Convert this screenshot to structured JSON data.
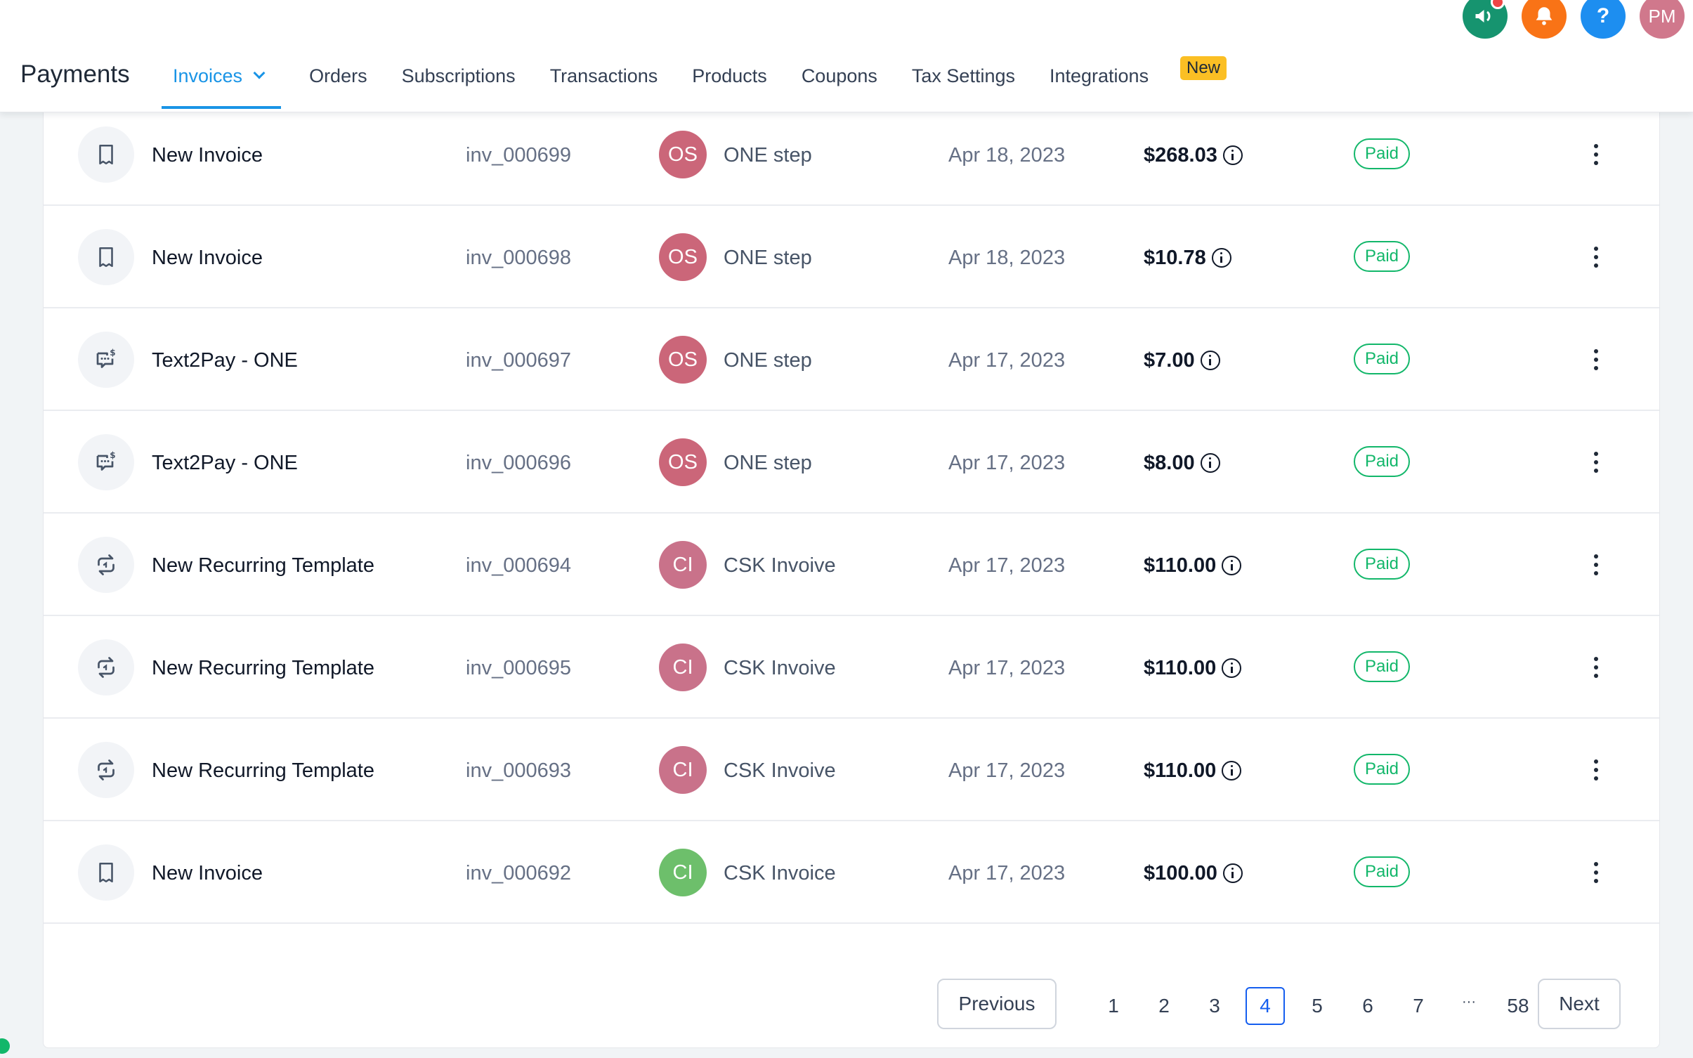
{
  "header": {
    "title": "Payments",
    "tabs": [
      {
        "label": "Invoices",
        "active": true
      },
      {
        "label": "Orders"
      },
      {
        "label": "Subscriptions"
      },
      {
        "label": "Transactions"
      },
      {
        "label": "Products"
      },
      {
        "label": "Coupons"
      },
      {
        "label": "Tax Settings"
      },
      {
        "label": "Integrations"
      }
    ],
    "new_badge": "New",
    "user_initials": "PM",
    "icons": [
      "megaphone-icon",
      "bell-icon",
      "help-icon",
      "avatar"
    ],
    "colors": {
      "megaphone": "#16946f",
      "bell": "#f97316",
      "help": "#1d8ef0",
      "avatar": "#d0788c",
      "accent": "#1994e6"
    }
  },
  "rows": [
    {
      "type_icon": "receipt-icon",
      "name": "New Invoice",
      "number": "inv_000699",
      "customer_initials": "OS",
      "customer": "ONE step",
      "customer_color": "#cb6679",
      "date": "Apr 18, 2023",
      "amount": "$268.03",
      "status": "Paid"
    },
    {
      "type_icon": "receipt-icon",
      "name": "New Invoice",
      "number": "inv_000698",
      "customer_initials": "OS",
      "customer": "ONE step",
      "customer_color": "#cb6679",
      "date": "Apr 18, 2023",
      "amount": "$10.78",
      "status": "Paid"
    },
    {
      "type_icon": "text2pay-icon",
      "name": "Text2Pay - ONE",
      "number": "inv_000697",
      "customer_initials": "OS",
      "customer": "ONE step",
      "customer_color": "#cb6679",
      "date": "Apr 17, 2023",
      "amount": "$7.00",
      "status": "Paid"
    },
    {
      "type_icon": "text2pay-icon",
      "name": "Text2Pay - ONE",
      "number": "inv_000696",
      "customer_initials": "OS",
      "customer": "ONE step",
      "customer_color": "#cb6679",
      "date": "Apr 17, 2023",
      "amount": "$8.00",
      "status": "Paid"
    },
    {
      "type_icon": "recurring-icon",
      "name": "New Recurring Template",
      "number": "inv_000694",
      "customer_initials": "CI",
      "customer": "CSK Invoive",
      "customer_color": "#c9728a",
      "date": "Apr 17, 2023",
      "amount": "$110.00",
      "status": "Paid"
    },
    {
      "type_icon": "recurring-icon",
      "name": "New Recurring Template",
      "number": "inv_000695",
      "customer_initials": "CI",
      "customer": "CSK Invoive",
      "customer_color": "#c9728a",
      "date": "Apr 17, 2023",
      "amount": "$110.00",
      "status": "Paid"
    },
    {
      "type_icon": "recurring-icon",
      "name": "New Recurring Template",
      "number": "inv_000693",
      "customer_initials": "CI",
      "customer": "CSK Invoive",
      "customer_color": "#c9728a",
      "date": "Apr 17, 2023",
      "amount": "$110.00",
      "status": "Paid"
    },
    {
      "type_icon": "receipt-icon",
      "name": "New Invoice",
      "number": "inv_000692",
      "customer_initials": "CI",
      "customer": "CSK Invoice",
      "customer_color": "#6dbf6b",
      "date": "Apr 17, 2023",
      "amount": "$100.00",
      "status": "Paid"
    }
  ],
  "pagination": {
    "previous": "Previous",
    "next": "Next",
    "pages": [
      "1",
      "2",
      "3",
      "4",
      "5",
      "6",
      "7",
      "···",
      "58"
    ],
    "current": "4"
  }
}
